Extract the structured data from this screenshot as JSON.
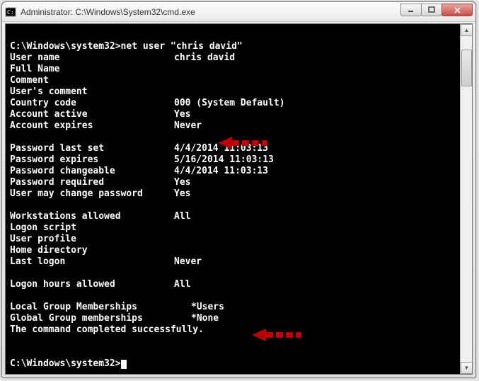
{
  "window": {
    "title": "Administrator: C:\\Windows\\System32\\cmd.exe"
  },
  "prompt1": {
    "cwd": "C:\\Windows\\system32>",
    "command": "net user \"chris david\""
  },
  "fields": {
    "user_name_label": "User name",
    "user_name_value": "chris david",
    "full_name_label": "Full Name",
    "comment_label": "Comment",
    "users_comment_label": "User's comment",
    "country_code_label": "Country code",
    "country_code_value": "000 (System Default)",
    "account_active_label": "Account active",
    "account_active_value": "Yes",
    "account_expires_label": "Account expires",
    "account_expires_value": "Never",
    "pw_last_set_label": "Password last set",
    "pw_last_set_value": "4/4/2014 11:03:13",
    "pw_expires_label": "Password expires",
    "pw_expires_value": "5/16/2014 11:03:13",
    "pw_changeable_label": "Password changeable",
    "pw_changeable_value": "4/4/2014 11:03:13",
    "pw_required_label": "Password required",
    "pw_required_value": "Yes",
    "user_may_change_label": "User may change password",
    "user_may_change_value": "Yes",
    "workstations_label": "Workstations allowed",
    "workstations_value": "All",
    "logon_script_label": "Logon script",
    "user_profile_label": "User profile",
    "home_dir_label": "Home directory",
    "last_logon_label": "Last logon",
    "last_logon_value": "Never",
    "logon_hours_label": "Logon hours allowed",
    "logon_hours_value": "All",
    "local_groups_label": "Local Group Memberships",
    "local_groups_value": "*Users",
    "global_groups_label": "Global Group memberships",
    "global_groups_value": "*None",
    "completed_msg": "The command completed successfully."
  },
  "prompt2": {
    "cwd": "C:\\Windows\\system32>"
  },
  "arrows": {
    "color": "#c00000"
  }
}
